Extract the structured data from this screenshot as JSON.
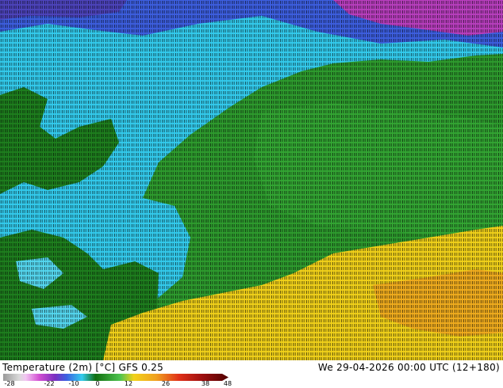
{
  "map": {
    "colors": {
      "deep_cold": "#5b2d9e",
      "magenta": "#b93fbf",
      "blue": "#3d5fe0",
      "mid_blue": "#2d9cdb",
      "cyan": "#33ccee",
      "light_cyan": "#55d8f0",
      "green_dark": "#1e7f1e",
      "green": "#2e9c2e",
      "green_light": "#33a633",
      "yellow": "#f2d21a",
      "orange": "#f0a020"
    }
  },
  "footer": {
    "title": "Temperature (2m) [°C] GFS 0.25",
    "validity": "We 29-04-2026 00:00 UTC (12+180)"
  },
  "legend": {
    "ticks": [
      "-28",
      "-22",
      "-10",
      "0",
      "12",
      "26",
      "38",
      "48"
    ]
  }
}
